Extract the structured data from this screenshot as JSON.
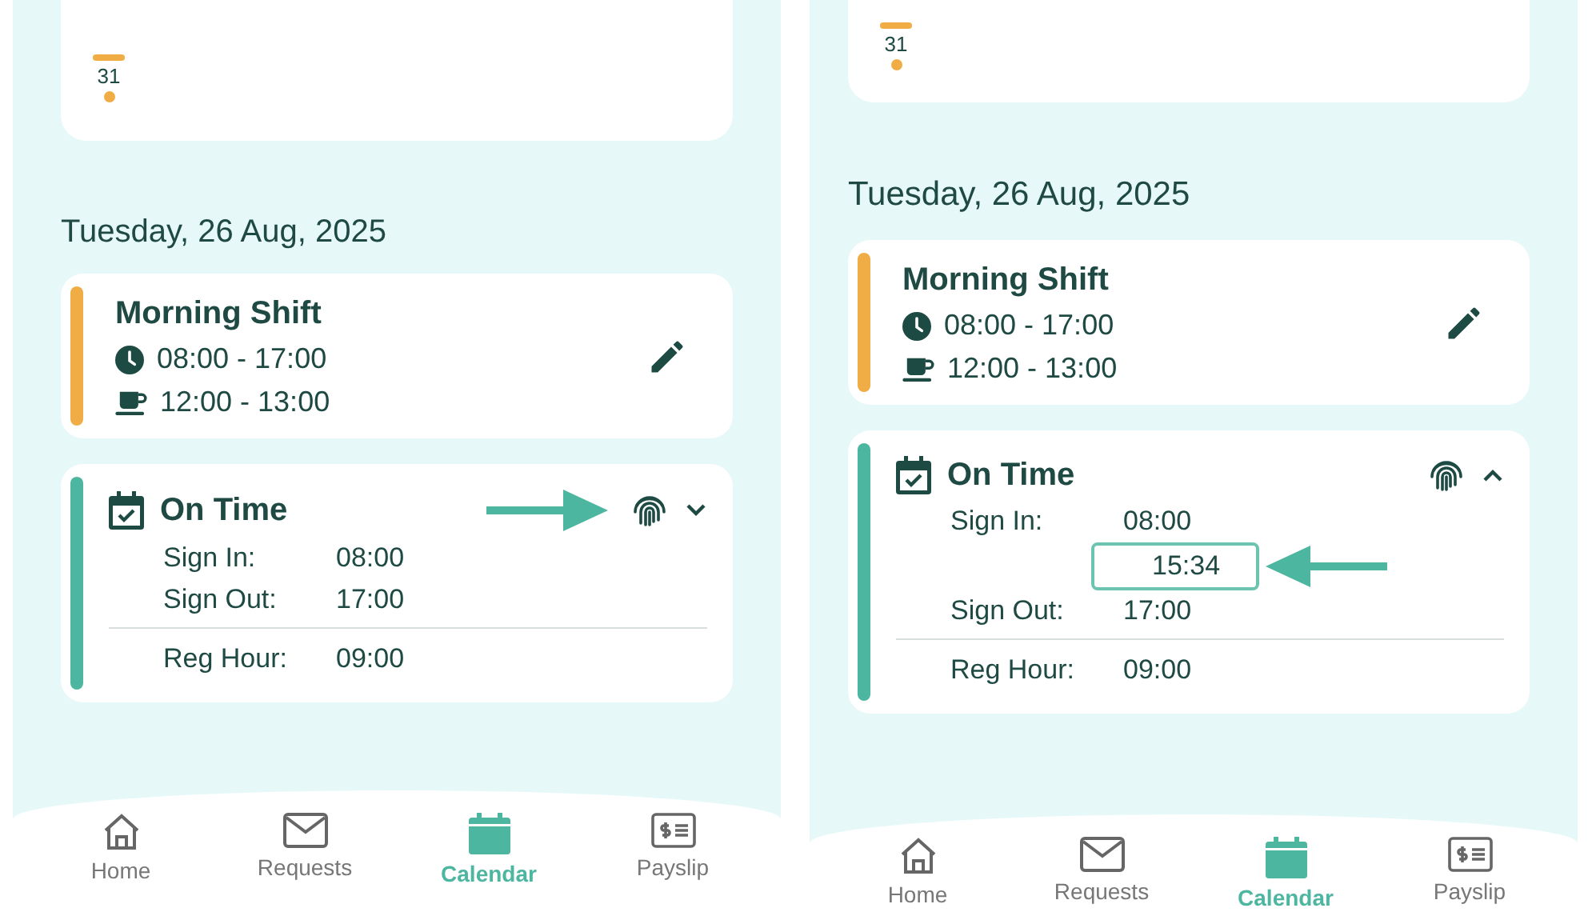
{
  "screens": [
    {
      "peek": {
        "day": "31",
        "color": "#f0ad45"
      },
      "date_heading": "Tuesday, 26 Aug, 2025",
      "shift": {
        "title": "Morning Shift",
        "hours": "08:00 - 17:00",
        "break": "12:00 - 13:00",
        "color": "#f0ad45"
      },
      "attendance": {
        "status": "On Time",
        "color": "#4db6a0",
        "expanded": false,
        "arrow_shown": true,
        "rows": [
          {
            "label": "Sign In:",
            "value": "08:00",
            "punches": []
          },
          {
            "label": "Sign Out:",
            "value": "17:00",
            "punches": []
          }
        ],
        "reg": {
          "label": "Reg Hour:",
          "value": "09:00"
        }
      },
      "nav": [
        {
          "label": "Home",
          "selected": false
        },
        {
          "label": "Requests",
          "selected": false
        },
        {
          "label": "Calendar",
          "selected": true
        },
        {
          "label": "Payslip",
          "selected": false
        }
      ]
    },
    {
      "peek": {
        "day": "31",
        "color": "#f0ad45"
      },
      "date_heading": "Tuesday, 26 Aug, 2025",
      "shift": {
        "title": "Morning Shift",
        "hours": "08:00 - 17:00",
        "break": "12:00 - 13:00",
        "color": "#f0ad45"
      },
      "attendance": {
        "status": "On Time",
        "color": "#4db6a0",
        "expanded": true,
        "arrow_shown": false,
        "rows": [
          {
            "label": "Sign In:",
            "value": "08:00",
            "punches": [
              {
                "value": "15:34",
                "arrow_shown": true
              }
            ]
          },
          {
            "label": "Sign Out:",
            "value": "17:00",
            "punches": []
          }
        ],
        "reg": {
          "label": "Reg Hour:",
          "value": "09:00"
        }
      },
      "nav": [
        {
          "label": "Home",
          "selected": false
        },
        {
          "label": "Requests",
          "selected": false
        },
        {
          "label": "Calendar",
          "selected": true
        },
        {
          "label": "Payslip",
          "selected": false
        }
      ]
    }
  ]
}
